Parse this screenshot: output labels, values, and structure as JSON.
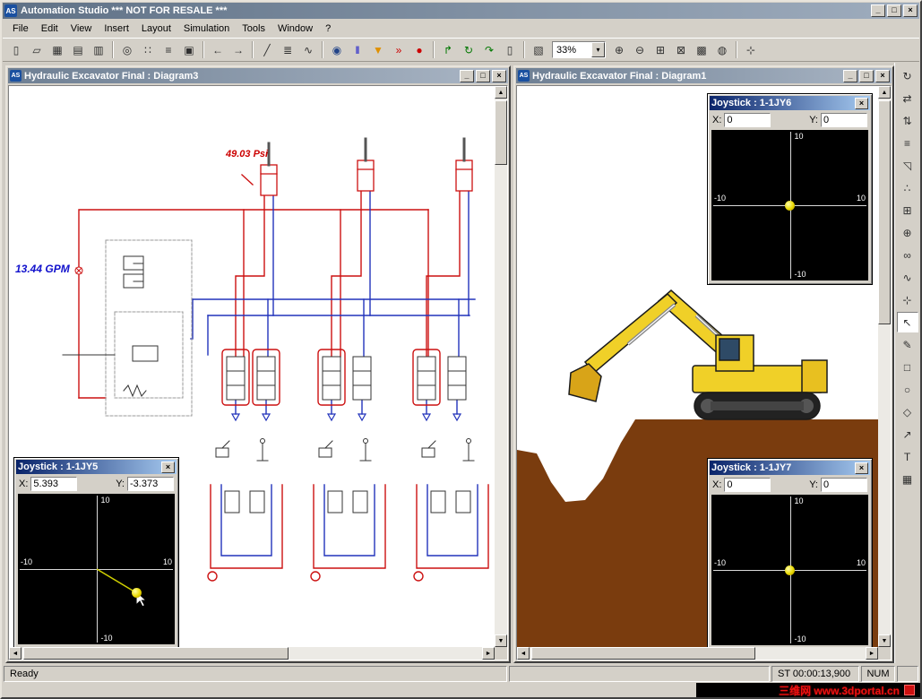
{
  "icons": {
    "close": "×",
    "scroll_up": "▲",
    "scroll_down": "▼",
    "scroll_left": "◄",
    "scroll_right": "►",
    "dropdown": "▾"
  },
  "app": {
    "icon_text": "AS",
    "title": "Automation Studio   *** NOT FOR RESALE ***",
    "window_buttons": [
      {
        "name": "minimize-button",
        "glyph": "_"
      },
      {
        "name": "maximize-button",
        "glyph": "□"
      },
      {
        "name": "close-button",
        "glyph": "×"
      }
    ],
    "menus": [
      {
        "name": "menu-file",
        "label": "File"
      },
      {
        "name": "menu-edit",
        "label": "Edit"
      },
      {
        "name": "menu-view",
        "label": "View"
      },
      {
        "name": "menu-insert",
        "label": "Insert"
      },
      {
        "name": "menu-layout",
        "label": "Layout"
      },
      {
        "name": "menu-simulation",
        "label": "Simulation"
      },
      {
        "name": "menu-tools",
        "label": "Tools"
      },
      {
        "name": "menu-window",
        "label": "Window"
      },
      {
        "name": "menu-help",
        "label": "?"
      }
    ],
    "zoom_value": "33%"
  },
  "toolbar": {
    "items": [
      {
        "name": "new-button",
        "glyph": "▯"
      },
      {
        "name": "open-button",
        "glyph": "▱"
      },
      {
        "name": "save-button",
        "glyph": "▦"
      },
      {
        "name": "print-button",
        "glyph": "▤"
      },
      {
        "name": "print-preview-button",
        "glyph": "▥"
      },
      {
        "sep": true
      },
      {
        "name": "find-component-button",
        "glyph": "◎"
      },
      {
        "name": "library-explorer-button",
        "glyph": "∷"
      },
      {
        "name": "sort-button",
        "glyph": "≡"
      },
      {
        "name": "snapshot-button",
        "glyph": "▣"
      },
      {
        "sep": true
      },
      {
        "name": "back-button",
        "glyph": "←"
      },
      {
        "name": "forward-button",
        "glyph": "→"
      },
      {
        "sep": true
      },
      {
        "name": "line-tool-button",
        "glyph": "╱"
      },
      {
        "name": "list-button",
        "glyph": "≣"
      },
      {
        "name": "links-button",
        "glyph": "∿"
      },
      {
        "sep": true
      },
      {
        "name": "simulation-run-button",
        "glyph": "◉",
        "color": "#224488"
      },
      {
        "name": "pause-button",
        "glyph": "‖",
        "color": "#0000cc"
      },
      {
        "name": "step-button",
        "glyph": "▼",
        "color": "#e09000"
      },
      {
        "name": "fast-forward-button",
        "glyph": "»",
        "color": "#cc0000"
      },
      {
        "name": "stop-button",
        "glyph": "●",
        "color": "#cc0000"
      },
      {
        "sep": true
      },
      {
        "name": "step-into-button",
        "glyph": "↱",
        "color": "#007700"
      },
      {
        "name": "loop-button",
        "glyph": "↻",
        "color": "#007700"
      },
      {
        "name": "continue-button",
        "glyph": "↷",
        "color": "#007700"
      },
      {
        "name": "report-button",
        "glyph": "▯"
      },
      {
        "sep": true
      },
      {
        "name": "plotter-button",
        "glyph": "▧"
      }
    ],
    "items_right": [
      {
        "name": "zoom-in-button",
        "glyph": "⊕"
      },
      {
        "name": "zoom-out-button",
        "glyph": "⊖"
      },
      {
        "name": "zoom-window-button",
        "glyph": "⊞"
      },
      {
        "name": "zoom-page-button",
        "glyph": "⊠"
      },
      {
        "name": "grid-button",
        "glyph": "▩"
      },
      {
        "name": "zoom-selection-button",
        "glyph": "◍"
      },
      {
        "sep": true
      },
      {
        "name": "pan-button",
        "glyph": "⊹"
      }
    ]
  },
  "right_toolbar": {
    "items": [
      {
        "name": "rotate-tool-button",
        "glyph": "↻"
      },
      {
        "name": "flip-horizontal-button",
        "glyph": "⇄"
      },
      {
        "name": "flip-vertical-button",
        "glyph": "⇅"
      },
      {
        "name": "align-button",
        "glyph": "≡"
      },
      {
        "name": "transform-button",
        "glyph": "◹"
      },
      {
        "name": "node-edit-button",
        "glyph": "∴"
      },
      {
        "name": "snap-grid-button",
        "glyph": "⊞"
      },
      {
        "name": "insert-port-button",
        "glyph": "⊕"
      },
      {
        "name": "link-button",
        "glyph": "∞"
      },
      {
        "name": "polyline-button",
        "glyph": "∿"
      },
      {
        "name": "measure-button",
        "glyph": "⊹"
      },
      {
        "name": "pointer-tool-button",
        "glyph": "↖",
        "selected": true
      },
      {
        "name": "pen-tool-button",
        "glyph": "✎"
      },
      {
        "name": "rectangle-tool-button",
        "glyph": "□"
      },
      {
        "name": "ellipse-tool-button",
        "glyph": "○"
      },
      {
        "name": "polygon-tool-button",
        "glyph": "◇"
      },
      {
        "name": "arrow-tool-button",
        "glyph": "↗"
      },
      {
        "name": "text-tool-button",
        "glyph": "T"
      },
      {
        "name": "image-tool-button",
        "glyph": "▦"
      }
    ]
  },
  "left_window": {
    "title": "Hydraulic Excavator Final : Diagram3",
    "pressure_label": "49.03 Psi",
    "flow_label": "13.44 GPM"
  },
  "right_window": {
    "title": "Hydraulic Excavator Final : Diagram1"
  },
  "joysticks": {
    "axis": {
      "top": "10",
      "left": "-10",
      "right": "10",
      "bottom": "-10"
    },
    "jy5": {
      "title": "Joystick : 1-1JY5",
      "x_label": "X:",
      "y_label": "Y:",
      "x_value": "5.393",
      "y_value": "-3.373"
    },
    "jy6": {
      "title": "Joystick : 1-1JY6",
      "x_label": "X:",
      "y_label": "Y:",
      "x_value": "0",
      "y_value": "0"
    },
    "jy7": {
      "title": "Joystick : 1-1JY7",
      "x_label": "X:",
      "y_label": "Y:",
      "x_value": "0",
      "y_value": "0"
    }
  },
  "statusbar": {
    "ready": "Ready",
    "sim_time": "ST 00:00:13,900",
    "num": "NUM"
  },
  "watermark": {
    "text": "三维网 www.3dportal.cn"
  }
}
